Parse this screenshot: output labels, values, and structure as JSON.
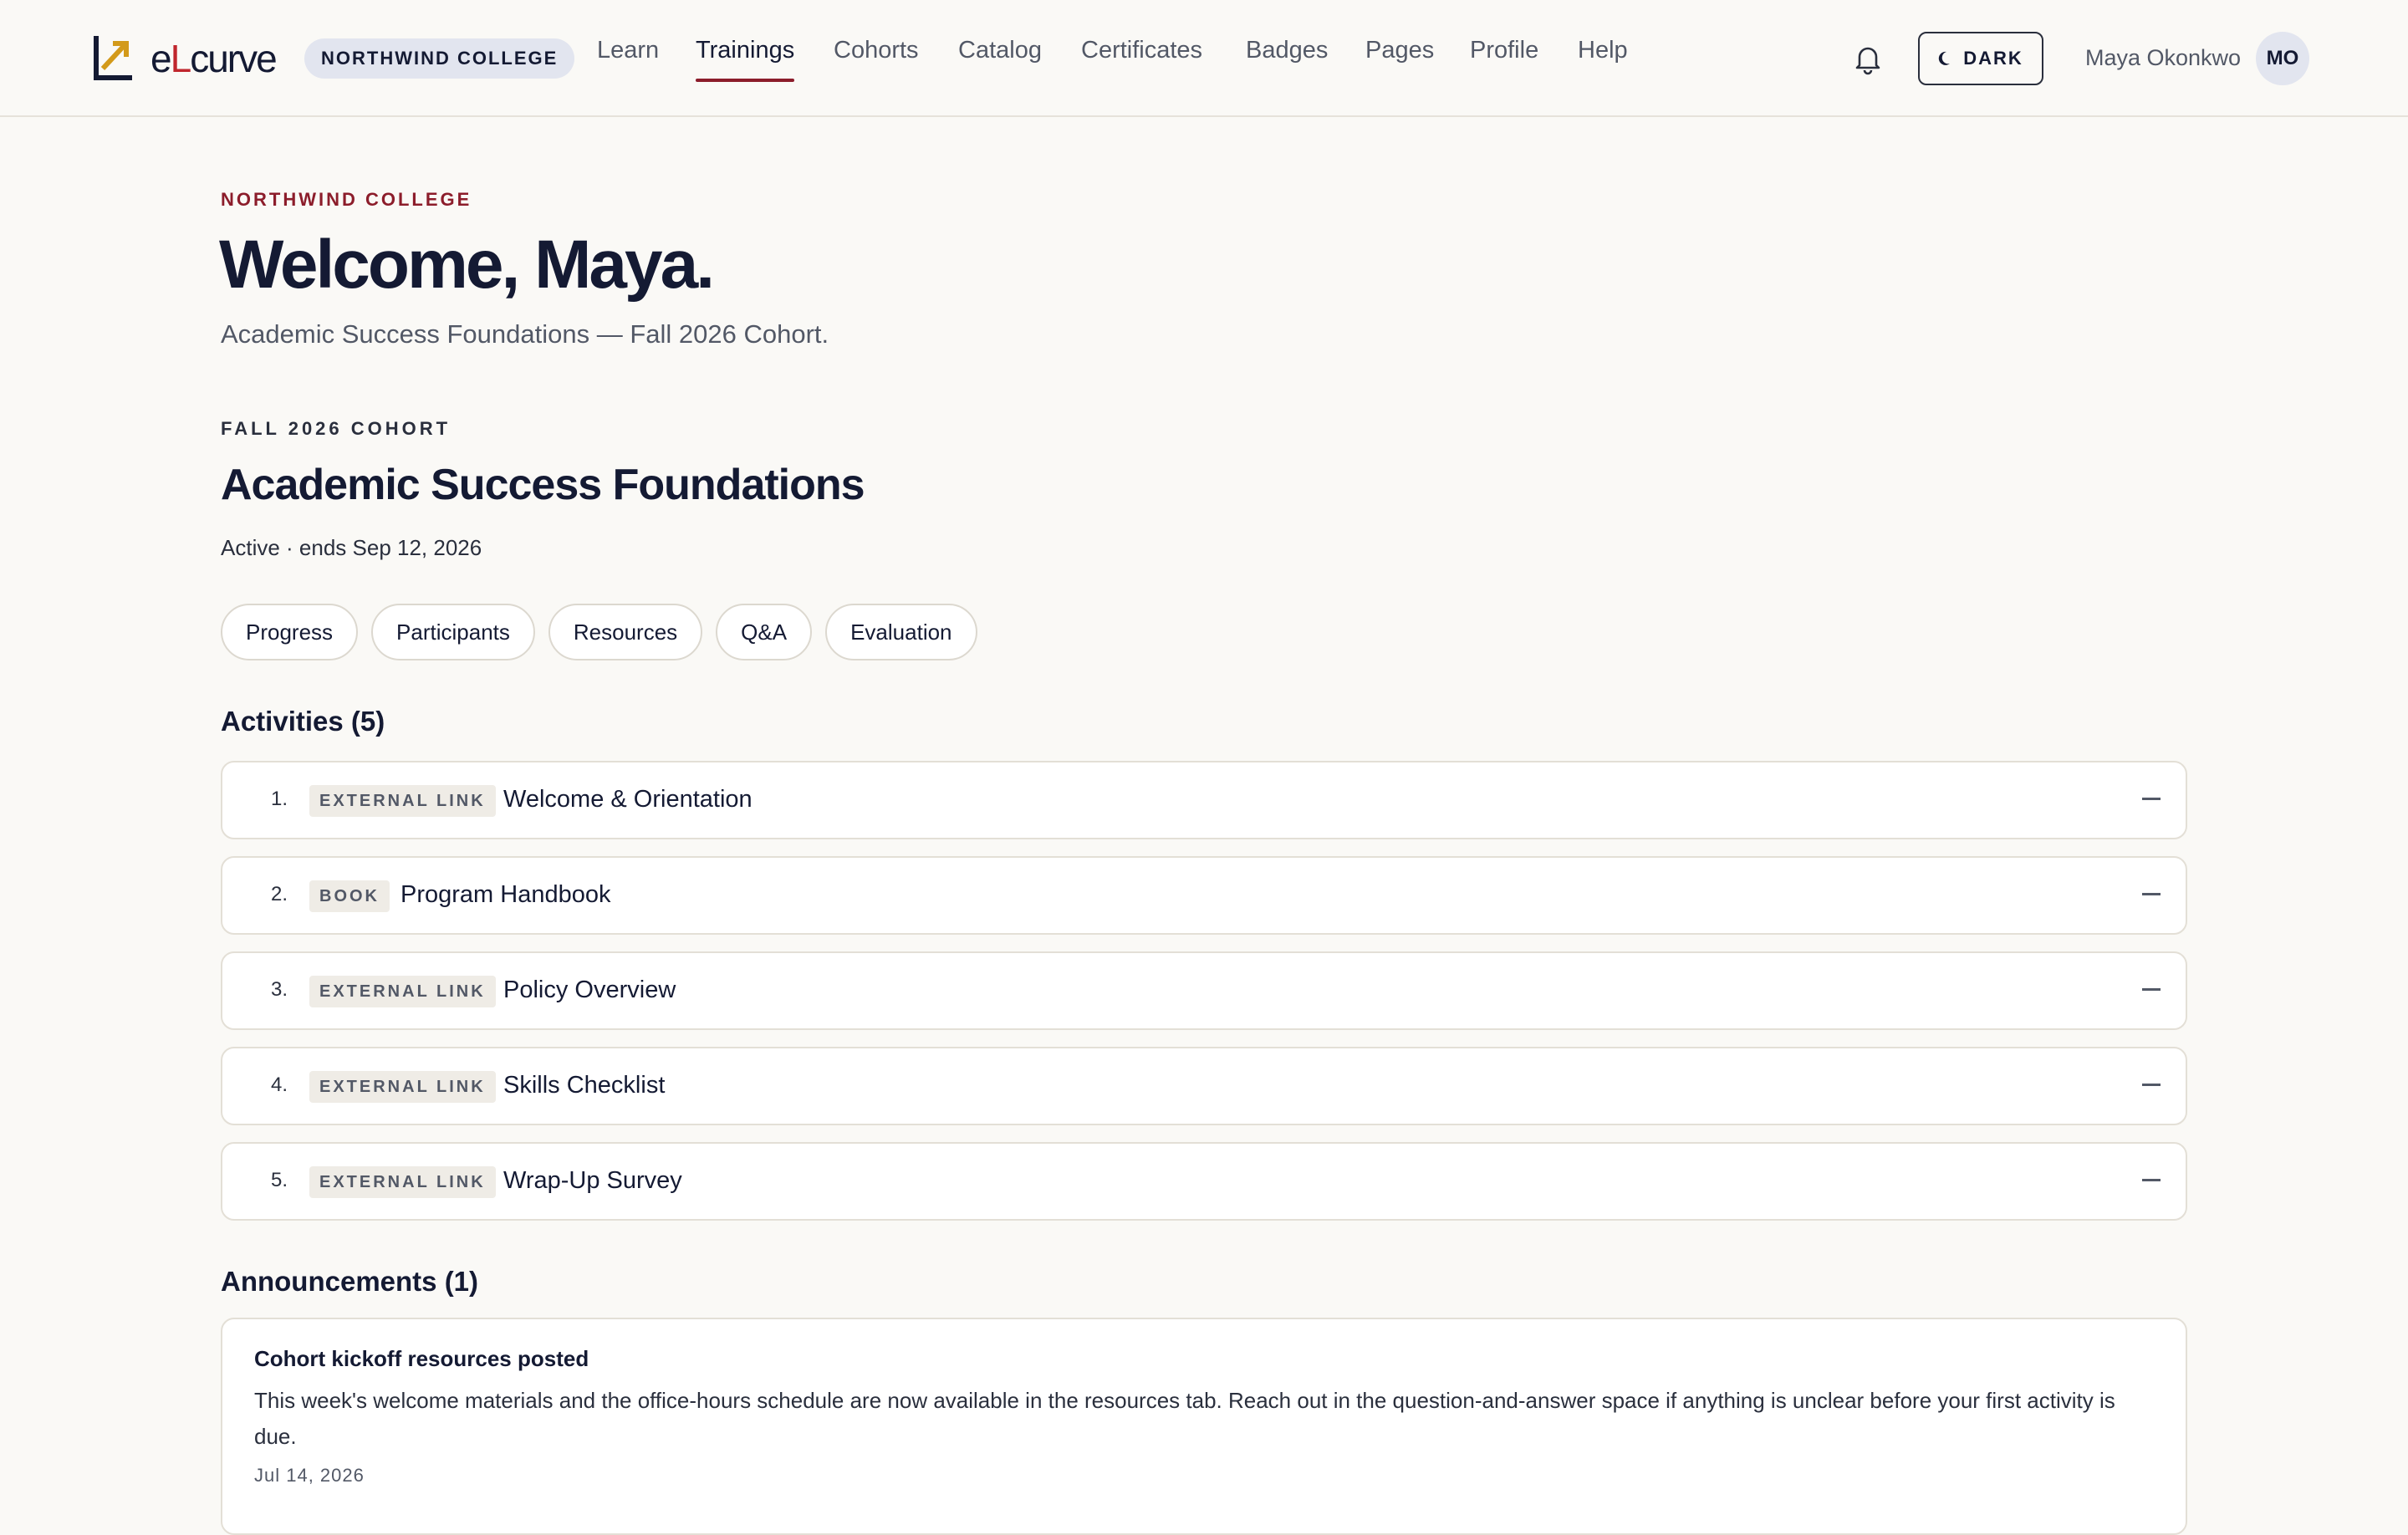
{
  "brand": {
    "logo_text_before": "e",
    "logo_text_accent": "L",
    "logo_text_after": "curve",
    "org_badge": "NORTHWIND COLLEGE",
    "accent_color": "#8c1d2b"
  },
  "nav": {
    "items": [
      {
        "label": "Learn"
      },
      {
        "label": "Trainings",
        "active": true
      },
      {
        "label": "Cohorts"
      },
      {
        "label": "Catalog"
      },
      {
        "label": "Certificates"
      },
      {
        "label": "Badges"
      },
      {
        "label": "Pages"
      },
      {
        "label": "Profile"
      },
      {
        "label": "Help"
      }
    ]
  },
  "header": {
    "notifications_icon": "bell-icon",
    "theme_toggle_label": "DARK",
    "theme_toggle_icon": "moon-icon",
    "user_name": "Maya Okonkwo",
    "user_initials": "MO"
  },
  "hero": {
    "eyebrow": "NORTHWIND COLLEGE",
    "greeting": "Welcome, Maya.",
    "subtitle": "Academic Success Foundations — Fall 2026 Cohort."
  },
  "cohort": {
    "eyebrow": "FALL 2026 COHORT",
    "title": "Academic Success Foundations",
    "status": "Active · ends Sep 12, 2026",
    "tabs": [
      {
        "label": "Progress"
      },
      {
        "label": "Participants"
      },
      {
        "label": "Resources"
      },
      {
        "label": "Q&A"
      },
      {
        "label": "Evaluation"
      }
    ]
  },
  "activities": {
    "heading": "Activities (5)",
    "items": [
      {
        "num": "1.",
        "tag": "EXTERNAL LINK",
        "title": "Welcome & Orientation"
      },
      {
        "num": "2.",
        "tag": "BOOK",
        "title": "Program Handbook"
      },
      {
        "num": "3.",
        "tag": "EXTERNAL LINK",
        "title": "Policy Overview"
      },
      {
        "num": "4.",
        "tag": "EXTERNAL LINK",
        "title": "Skills Checklist"
      },
      {
        "num": "5.",
        "tag": "EXTERNAL LINK",
        "title": "Wrap-Up Survey"
      }
    ]
  },
  "announcements": {
    "heading": "Announcements (1)",
    "items": [
      {
        "title": "Cohort kickoff resources posted",
        "body": "This week's welcome materials and the office-hours schedule are now available in the resources tab. Reach out in the question-and-answer space if anything is unclear before your first activity is due.",
        "date": "Jul 14, 2026"
      }
    ]
  }
}
